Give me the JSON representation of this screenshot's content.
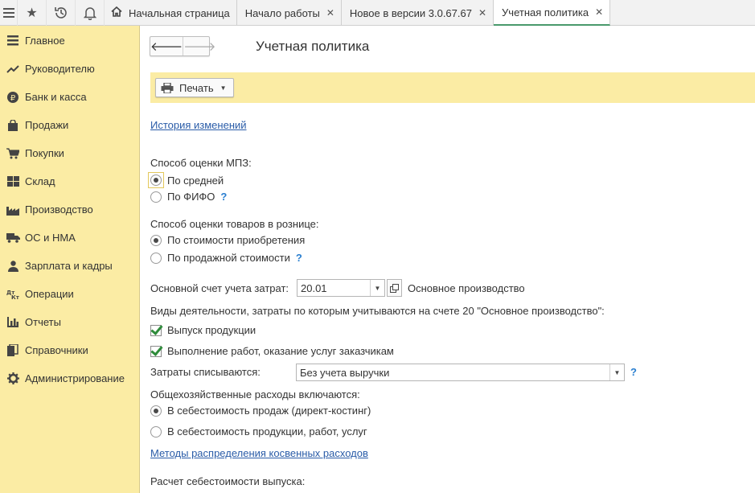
{
  "topbar": {
    "icons": [
      "apps-icon",
      "favorites-star-icon",
      "history-icon",
      "notifications-bell-icon"
    ],
    "tabs": [
      {
        "label": "Начальная страница",
        "closable": false
      },
      {
        "label": "Начало работы",
        "closable": true
      },
      {
        "label": "Новое в версии 3.0.67.67",
        "closable": true
      },
      {
        "label": "Учетная политика",
        "closable": true
      }
    ]
  },
  "sidebar": {
    "items": [
      {
        "label": "Главное",
        "icon": "menu-lines-icon"
      },
      {
        "label": "Руководителю",
        "icon": "trend-chart-icon"
      },
      {
        "label": "Банк и касса",
        "icon": "ruble-coin-icon"
      },
      {
        "label": "Продажи",
        "icon": "shopping-bag-icon"
      },
      {
        "label": "Покупки",
        "icon": "cart-icon"
      },
      {
        "label": "Склад",
        "icon": "warehouse-grid-icon"
      },
      {
        "label": "Производство",
        "icon": "factory-icon"
      },
      {
        "label": "ОС и НМА",
        "icon": "truck-icon"
      },
      {
        "label": "Зарплата и кадры",
        "icon": "person-icon"
      },
      {
        "label": "Операции",
        "icon": "dt-kt-icon"
      },
      {
        "label": "Отчеты",
        "icon": "bar-chart-icon"
      },
      {
        "label": "Справочники",
        "icon": "books-icon"
      },
      {
        "label": "Администрирование",
        "icon": "gear-icon"
      }
    ]
  },
  "page": {
    "title": "Учетная политика",
    "print_label": "Печать",
    "history_link": "История изменений",
    "mpz": {
      "label": "Способ оценки МПЗ:",
      "options": [
        "По средней",
        "По ФИФО"
      ],
      "selected": 0
    },
    "retail": {
      "label": "Способ оценки товаров в рознице:",
      "options": [
        "По стоимости приобретения",
        "По продажной стоимости"
      ],
      "selected": 0
    },
    "cost_account": {
      "label": "Основной счет учета затрат:",
      "value": "20.01",
      "description": "Основное производство"
    },
    "activities": {
      "label": "Виды деятельности, затраты по которым учитываются на счете 20 \"Основное производство\":",
      "items": [
        {
          "label": "Выпуск продукции",
          "checked": true
        },
        {
          "label": "Выполнение работ, оказание услуг заказчикам",
          "checked": true
        }
      ]
    },
    "writeoff": {
      "label": "Затраты списываются:",
      "value": "Без учета выручки"
    },
    "overhead": {
      "label": "Общехозяйственные расходы включаются:",
      "options": [
        "В себестоимость продаж (директ-костинг)",
        "В  себестоимость продукции, работ, услуг"
      ],
      "selected": 0
    },
    "indirect_link": "Методы распределения косвенных расходов",
    "output_cost_label": "Расчет себестоимости выпуска:",
    "help_mark": "?",
    "colors": {
      "sidebar_bg": "#fbeca4",
      "link": "#2a5ca8",
      "help": "#2a7fd0",
      "active_tab_underline": "#4a9a6c"
    }
  }
}
